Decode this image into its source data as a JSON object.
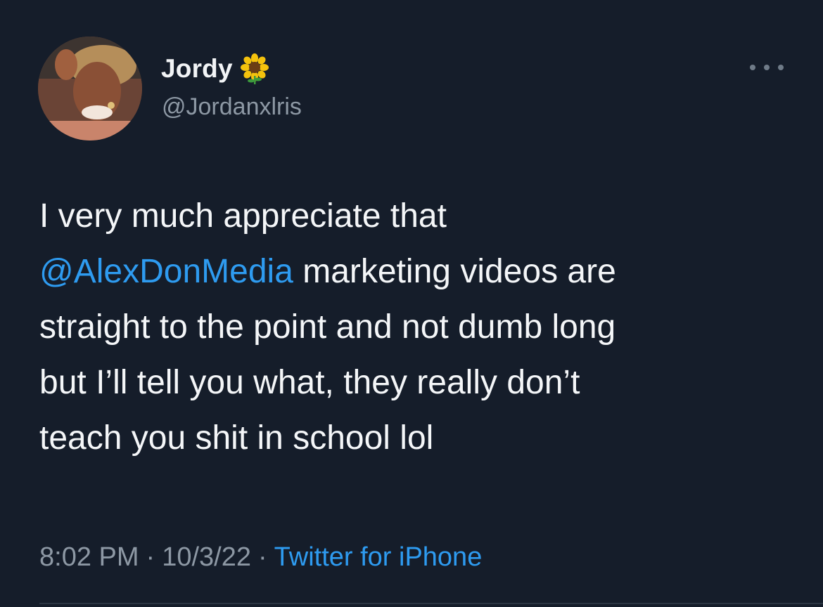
{
  "colors": {
    "background": "#151d2a",
    "text": "#f4f6f8",
    "secondary_text": "#8d98a4",
    "link": "#2e9bf0"
  },
  "author": {
    "name": "Jordy",
    "name_emoji_icon": "sunflower-icon",
    "handle": "@Jordanxlris",
    "avatar_icon": "profile-photo"
  },
  "more_menu_icon": "more-horizontal-icon",
  "tweet": {
    "line1": "I very much appreciate that",
    "mention": "@AlexDonMedia",
    "line2_rest": " marketing videos are",
    "line3": "straight to the point and not dumb long",
    "line4": "but I’ll tell you what, they really don’t",
    "line5": "teach you shit in school lol"
  },
  "meta": {
    "time": "8:02 PM",
    "separator": "·",
    "date": "10/3/22",
    "source": "Twitter for iPhone"
  }
}
